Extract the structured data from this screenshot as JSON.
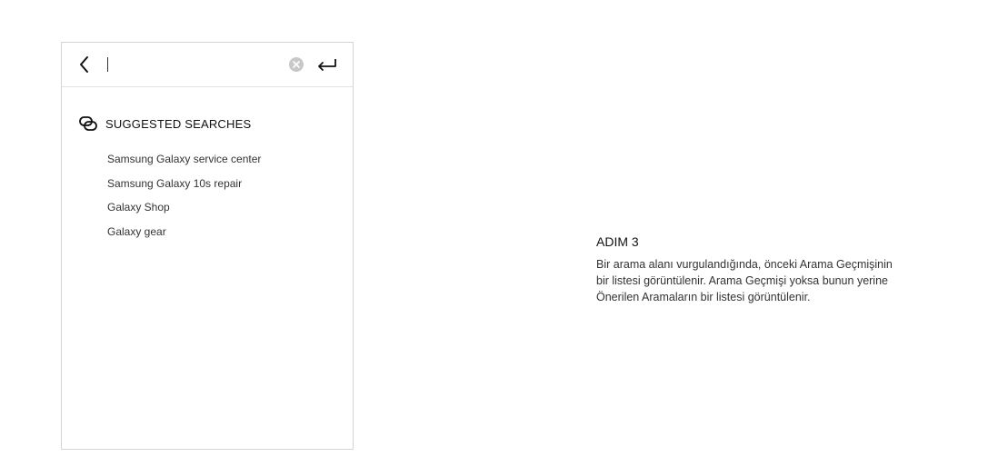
{
  "search": {
    "value": "",
    "back_icon": "chevron-left-icon",
    "clear_icon": "clear-circle-icon",
    "enter_icon": "enter-return-icon"
  },
  "suggestions": {
    "icon": "link-icon",
    "title": "SUGGESTED SEARCHES",
    "items": [
      "Samsung Galaxy service center",
      "Samsung Galaxy 10s repair",
      "Galaxy Shop",
      "Galaxy gear"
    ]
  },
  "step": {
    "title": "ADIM 3",
    "line1": "Bir arama alanı vurgulandığında, önceki Arama Geçmişinin",
    "line2": "bir listesi görüntülenir. Arama Geçmişi yoksa bunun yerine",
    "line3": "Önerilen Aramaların bir listesi görüntülenir."
  },
  "colors": {
    "border": "#d4d4d4",
    "clear_icon": "#c8c8c8",
    "text": "#1a1a1a"
  }
}
